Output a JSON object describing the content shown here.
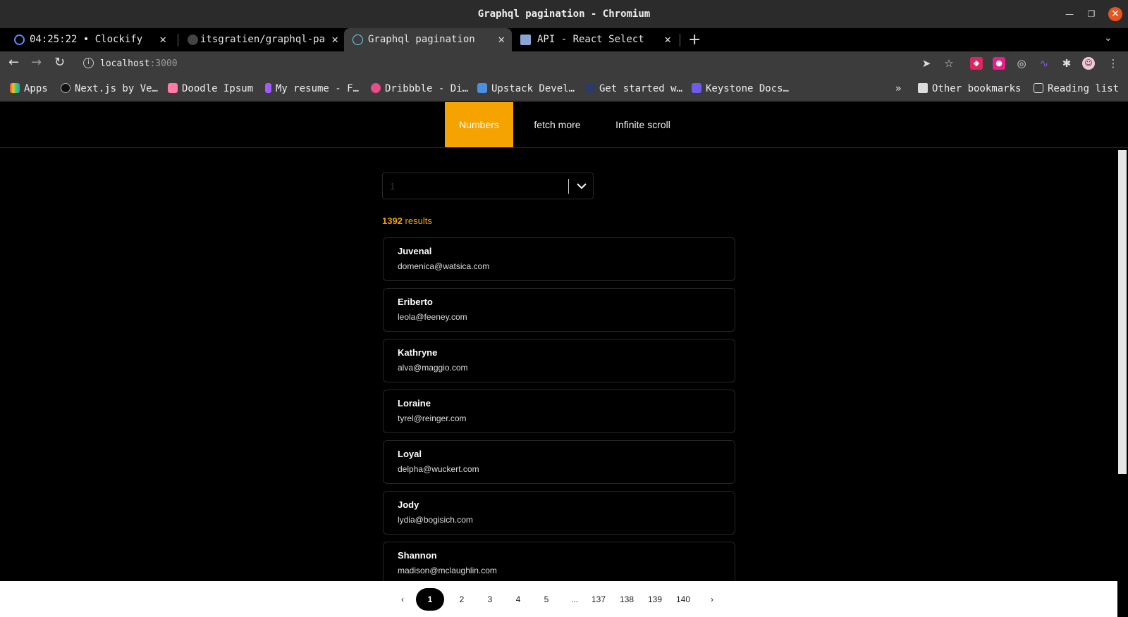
{
  "window": {
    "title": "Graphql pagination - Chromium"
  },
  "tabs": [
    {
      "label": "04:25:22 • Clockify",
      "favicon_color": "#5b8cff"
    },
    {
      "label": "itsgratien/graphql-pag",
      "favicon_color": "#444444"
    },
    {
      "label": "Graphql pagination",
      "favicon_color": "#61dafb"
    },
    {
      "label": "API - React Select",
      "favicon_color": "#8aa4d6"
    }
  ],
  "address": {
    "host": "localhost",
    "port": ":3000"
  },
  "bookmarks": [
    {
      "label": "Apps",
      "color": "#e74c3c"
    },
    {
      "label": "Next.js by Ve…",
      "color": "#111111"
    },
    {
      "label": "Doodle Ipsum",
      "color": "#ff7aa8"
    },
    {
      "label": "My resume - F…",
      "color": "#a259ff"
    },
    {
      "label": "Dribbble - Di…",
      "color": "#ea4c89"
    },
    {
      "label": "Upstack Devel…",
      "color": "#4a90e2"
    },
    {
      "label": "Get started w…",
      "color": "#2a3a6a"
    },
    {
      "label": "Keystone Docs…",
      "color": "#6c5ce7"
    },
    {
      "label": "Other bookmarks",
      "color": "#dddddd"
    },
    {
      "label": "Reading list",
      "color": "#dddddd"
    }
  ],
  "nav": {
    "items": [
      "Numbers",
      "fetch more",
      "Infinite scroll"
    ],
    "active": "Numbers"
  },
  "select": {
    "value": "1"
  },
  "results": {
    "count": "1392",
    "label": " results"
  },
  "users": [
    {
      "name": "Juvenal",
      "email": "domenica@watsica.com"
    },
    {
      "name": "Eriberto",
      "email": "leola@feeney.com"
    },
    {
      "name": "Kathryne",
      "email": "alva@maggio.com"
    },
    {
      "name": "Loraine",
      "email": "tyrel@reinger.com"
    },
    {
      "name": "Loyal",
      "email": "delpha@wuckert.com"
    },
    {
      "name": "Jody",
      "email": "lydia@bogisich.com"
    },
    {
      "name": "Shannon",
      "email": "madison@mclaughlin.com"
    }
  ],
  "pagination": {
    "prev": "‹",
    "next": "›",
    "pages": [
      "1",
      "2",
      "3",
      "4",
      "5",
      "...",
      "137",
      "138",
      "139",
      "140"
    ],
    "current": "1"
  },
  "colors": {
    "accent": "#f5a300"
  }
}
